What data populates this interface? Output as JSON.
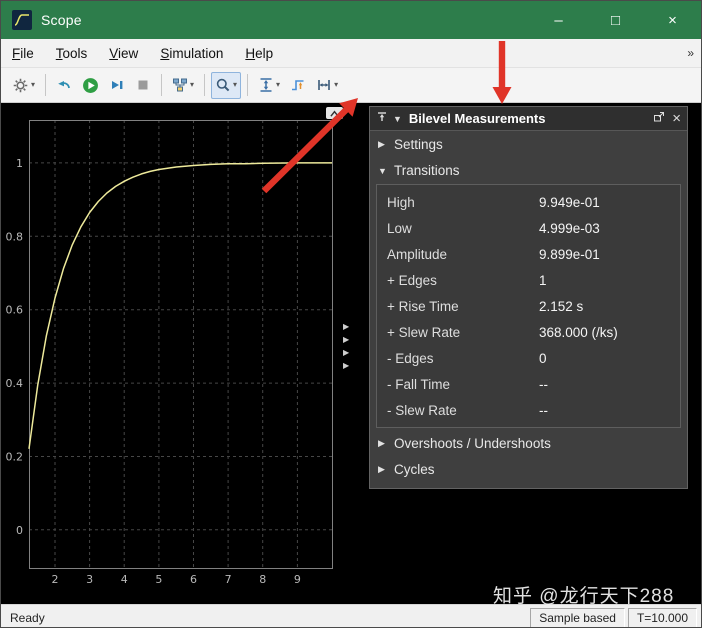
{
  "window": {
    "title": "Scope",
    "controls": {
      "minimize": "–",
      "maximize": "□",
      "close": "×"
    }
  },
  "menubar": {
    "items": [
      "File",
      "Tools",
      "View",
      "Simulation",
      "Help"
    ],
    "overflow": "»"
  },
  "toolbar": {
    "buttons": [
      {
        "name": "configuration-properties",
        "icon": "gear-icon",
        "caret": true
      },
      {
        "name": "step-back",
        "icon": "step-back-icon"
      },
      {
        "name": "run",
        "icon": "run-icon"
      },
      {
        "name": "step-forward",
        "icon": "step-forward-icon"
      },
      {
        "name": "stop",
        "icon": "stop-icon",
        "disabled": true
      },
      {
        "name": "highlight-simulink-block",
        "icon": "simulink-block-icon",
        "caret": true
      },
      {
        "name": "zoom",
        "icon": "zoom-icon",
        "caret": true,
        "pressed": true
      },
      {
        "name": "fit-to-view",
        "icon": "fit-to-view-icon",
        "caret": true
      },
      {
        "name": "trigger",
        "icon": "trigger-icon"
      },
      {
        "name": "measurements",
        "icon": "measurements-icon",
        "caret": true
      }
    ]
  },
  "panel": {
    "title": "Bilevel Measurements",
    "sections": {
      "settings": "Settings",
      "transitions": "Transitions",
      "overshoots": "Overshoots / Undershoots",
      "cycles": "Cycles"
    },
    "rows": [
      {
        "label": "High",
        "value": "9.949e-01"
      },
      {
        "label": "Low",
        "value": "4.999e-03"
      },
      {
        "label": "Amplitude",
        "value": "9.899e-01"
      },
      {
        "label": "+ Edges",
        "value": "1"
      },
      {
        "label": "+ Rise Time",
        "value": "2.152 s"
      },
      {
        "label": "+ Slew Rate",
        "value": "368.000 (/ks)"
      },
      {
        "label": "- Edges",
        "value": "0"
      },
      {
        "label": "- Fall Time",
        "value": "--"
      },
      {
        "label": "- Slew Rate",
        "value": "--"
      }
    ]
  },
  "chart_data": {
    "type": "line",
    "title": "",
    "xlabel": "",
    "ylabel": "",
    "xlim": [
      1.25,
      10
    ],
    "ylim": [
      -0.104,
      1.117
    ],
    "x_ticks": [
      2,
      3,
      4,
      5,
      6,
      7,
      8,
      9
    ],
    "y_ticks": [
      0,
      0.2,
      0.4,
      0.6,
      0.8,
      1
    ],
    "grid": true,
    "legend": false,
    "series": [
      {
        "name": "scope-signal-step-response",
        "color": "#eeea9b",
        "points": [
          [
            1.25,
            0.221
          ],
          [
            1.5,
            0.394
          ],
          [
            1.75,
            0.528
          ],
          [
            2,
            0.632
          ],
          [
            2.25,
            0.713
          ],
          [
            2.5,
            0.777
          ],
          [
            2.75,
            0.826
          ],
          [
            3,
            0.865
          ],
          [
            3.25,
            0.895
          ],
          [
            3.5,
            0.918
          ],
          [
            3.75,
            0.936
          ],
          [
            4,
            0.95
          ],
          [
            4.25,
            0.961
          ],
          [
            4.5,
            0.97
          ],
          [
            4.75,
            0.977
          ],
          [
            5,
            0.982
          ],
          [
            5.5,
            0.989
          ],
          [
            6,
            0.993
          ],
          [
            6.5,
            0.996
          ],
          [
            7,
            0.998
          ],
          [
            7.5,
            0.998
          ],
          [
            8,
            0.999
          ],
          [
            9,
            1.0
          ],
          [
            10,
            1.0
          ]
        ]
      }
    ]
  },
  "statusbar": {
    "status": "Ready",
    "sample_mode": "Sample based",
    "sim_time": "T=10.000"
  },
  "watermark": "知乎 @龙行天下288",
  "icons": {
    "tri_right": "▶",
    "tri_down": "▼",
    "caret_down": "▾",
    "panel_close": "×"
  },
  "colors": {
    "titlebar_green": "#2d7d4b",
    "annotation_red": "#e03428",
    "curve_yellow": "#eeea9b"
  }
}
